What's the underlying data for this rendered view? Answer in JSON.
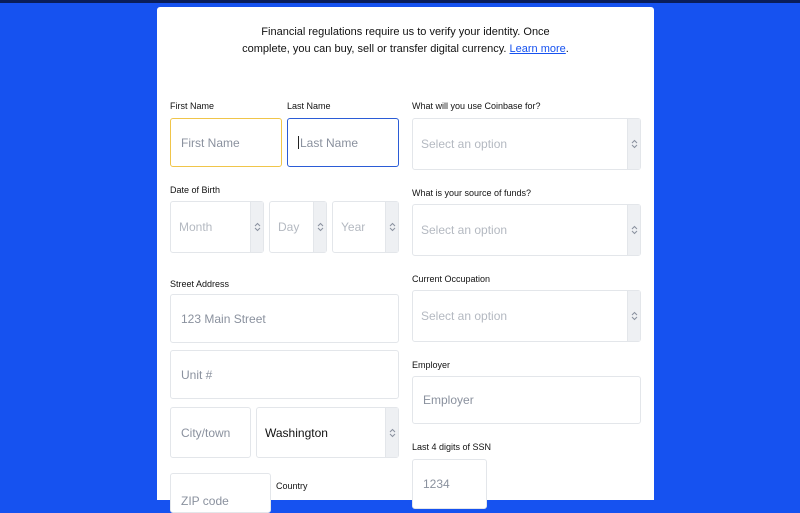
{
  "intro": {
    "text": "Financial regulations require us to verify your identity. Once complete, you can buy, sell or transfer digital currency.",
    "link": "Learn more",
    "suffix": "."
  },
  "form": {
    "first_name": {
      "label": "First Name",
      "placeholder": "First Name"
    },
    "last_name": {
      "label": "Last Name",
      "placeholder": "Last Name"
    },
    "dob": {
      "label": "Date of Birth",
      "month": "Month",
      "day": "Day",
      "year": "Year"
    },
    "street": {
      "label": "Street Address",
      "placeholder": "123 Main Street"
    },
    "unit": {
      "placeholder": "Unit #"
    },
    "city": {
      "placeholder": "City/town"
    },
    "state": {
      "value": "Washington"
    },
    "zip": {
      "placeholder": "ZIP code"
    },
    "country": {
      "label": "Country"
    },
    "use": {
      "label": "What will you use Coinbase for?",
      "placeholder": "Select an option"
    },
    "source": {
      "label": "What is your source of funds?",
      "placeholder": "Select an option"
    },
    "occupation": {
      "label": "Current Occupation",
      "placeholder": "Select an option"
    },
    "employer": {
      "label": "Employer",
      "placeholder": "Employer"
    },
    "ssn": {
      "label": "Last 4 digits of SSN",
      "placeholder": "1234"
    }
  },
  "colors": {
    "background": "#1652f0",
    "link": "#1652f0",
    "focus_yellow": "#f0c54a",
    "focus_blue": "#2b5cd6"
  },
  "icons": {
    "select_arrow": "up-down-chevron-icon"
  }
}
